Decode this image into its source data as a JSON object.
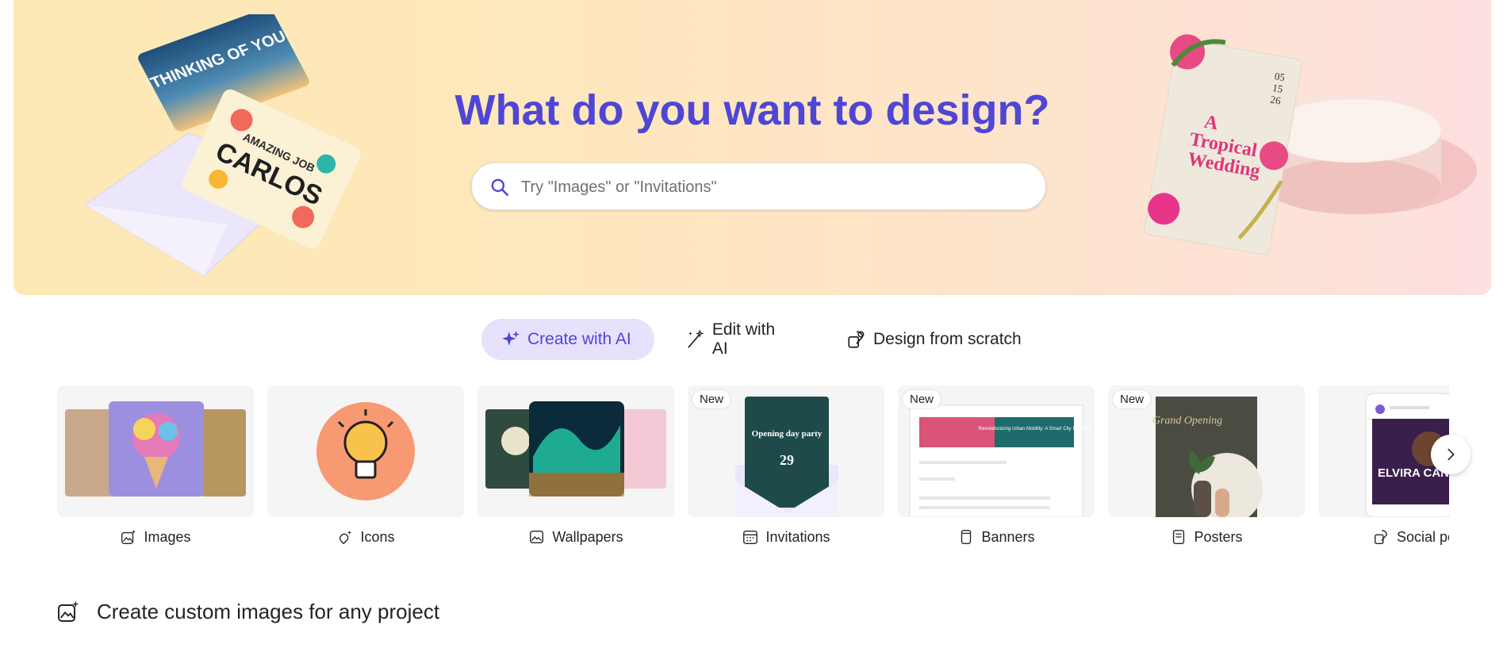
{
  "hero": {
    "title": "What do you want to design?",
    "search_placeholder": "Try \"Images\" or \"Invitations\"",
    "card_sky_text": "THINKING OF YOU",
    "card_tile_small": "AMAZING JOB",
    "card_tile_big": "CARLOS",
    "wedding_date_1": "05",
    "wedding_date_2": "15",
    "wedding_date_3": "26",
    "wedding_title_1": "A",
    "wedding_title_2": "Tropical",
    "wedding_title_3": "Wedding"
  },
  "tabs": [
    {
      "label": "Create with AI",
      "icon": "sparkle-icon",
      "active": true
    },
    {
      "label": "Edit with AI",
      "icon": "magic-wand-icon",
      "active": false
    },
    {
      "label": "Design from scratch",
      "icon": "shapes-icon",
      "active": false
    }
  ],
  "categories": [
    {
      "label": "Images",
      "icon": "image-sparkle-icon",
      "new": false,
      "badge": ""
    },
    {
      "label": "Icons",
      "icon": "icon-sparkle-icon",
      "new": false,
      "badge": ""
    },
    {
      "label": "Wallpapers",
      "icon": "wallpaper-icon",
      "new": false,
      "badge": ""
    },
    {
      "label": "Invitations",
      "icon": "calendar-icon",
      "new": true,
      "badge": "New"
    },
    {
      "label": "Banners",
      "icon": "phone-icon",
      "new": true,
      "badge": "New"
    },
    {
      "label": "Posters",
      "icon": "document-icon",
      "new": true,
      "badge": "New"
    },
    {
      "label": "Social pos",
      "icon": "social-icon",
      "new": false,
      "badge": ""
    }
  ],
  "thumb_text": {
    "invitation_title": "Opening day party",
    "invitation_day": "29",
    "banner_headline": "Revolutionizing Urban Mobility: A Smart City Initiative",
    "poster_title": "Grand Opening",
    "social_name": "ELVIRA CANO"
  },
  "section": {
    "title": "Create custom images for any project",
    "icon": "image-sparkle-icon"
  },
  "colors": {
    "accent": "#4f46d6",
    "active_tab_bg": "#e7e1fb"
  }
}
